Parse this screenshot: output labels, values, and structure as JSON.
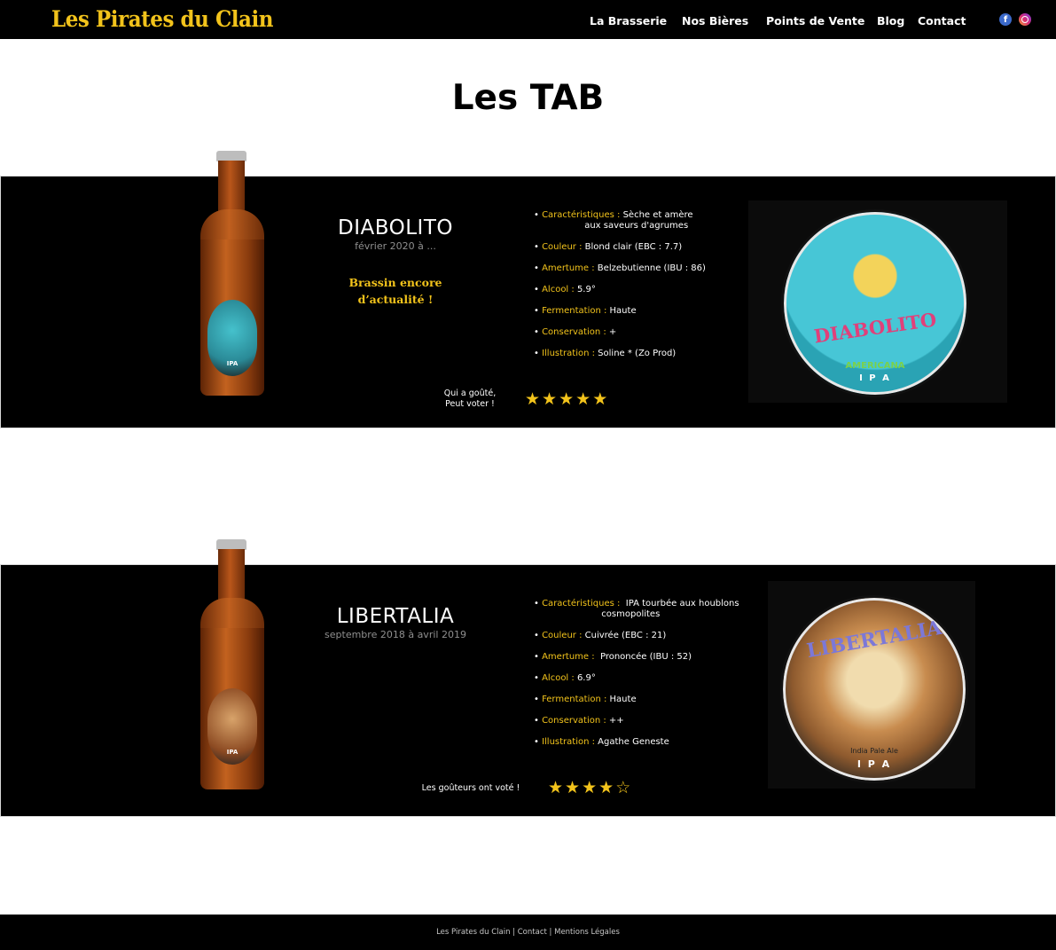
{
  "header": {
    "logo": "Les Pirates du Clain",
    "nav": [
      "La Brasserie",
      "Nos Bières",
      "Points de Vente",
      "Blog",
      "Contact"
    ],
    "social": [
      {
        "icon": "facebook-icon",
        "glyph": "f"
      },
      {
        "icon": "instagram-icon"
      }
    ]
  },
  "page": {
    "title": "Les TAB"
  },
  "beers": [
    {
      "name": "DIABOLITO",
      "dates": "février 2020 à ...",
      "note_line1": "Brassin encore",
      "note_line2": "d’actualité !",
      "specs": [
        {
          "label": "Caractéristiques :",
          "value": " Sèche et amère\n                  aux saveurs d'agrumes"
        },
        {
          "label": "Couleur :",
          "value": " Blond clair (EBC : 7.7)"
        },
        {
          "label": "Amertume :",
          "value": " Belzebutienne (IBU : 86)"
        },
        {
          "label": "Alcool :",
          "value": " 5.9°"
        },
        {
          "label": "Fermentation :",
          "value": " Haute"
        },
        {
          "label": "Conservation :",
          "value": " +"
        },
        {
          "label": "Illustration :",
          "value": " Soline * (Zo Prod)"
        }
      ],
      "vote_text_1": "Qui a goûté,",
      "vote_text_2": "Peut voter !",
      "rating": 5,
      "rating_max": 5,
      "label_art": {
        "word": "DIABOLITO",
        "sub1": "AMERICANA",
        "sub2": "I P A"
      }
    },
    {
      "name": "LIBERTALIA",
      "dates": "septembre 2018 à avril 2019",
      "specs": [
        {
          "label": "Caractéristiques :",
          "value": "  IPA tourbée aux houblons\n                        cosmopolites"
        },
        {
          "label": "Couleur :",
          "value": " Cuivrée (EBC : 21)"
        },
        {
          "label": "Amertume :",
          "value": "  Prononcée (IBU : 52)"
        },
        {
          "label": "Alcool :",
          "value": " 6.9°"
        },
        {
          "label": "Fermentation :",
          "value": " Haute"
        },
        {
          "label": "Conservation :",
          "value": " ++"
        },
        {
          "label": "Illustration :",
          "value": " Agathe Geneste"
        }
      ],
      "vote_text_1": "Les goûteurs ont voté !",
      "rating": 4,
      "rating_max": 5,
      "label_art": {
        "word": "LIBERTALIA",
        "sub1": "India Pale Ale",
        "sub2": "I P A"
      }
    }
  ],
  "footer": {
    "brand": "Les Pirates du Clain",
    "sep": " | ",
    "contact": "Contact",
    "legal": "Mentions Légales"
  },
  "colors": {
    "accent": "#f2c31b",
    "band": "#000000",
    "text": "#ffffff"
  }
}
